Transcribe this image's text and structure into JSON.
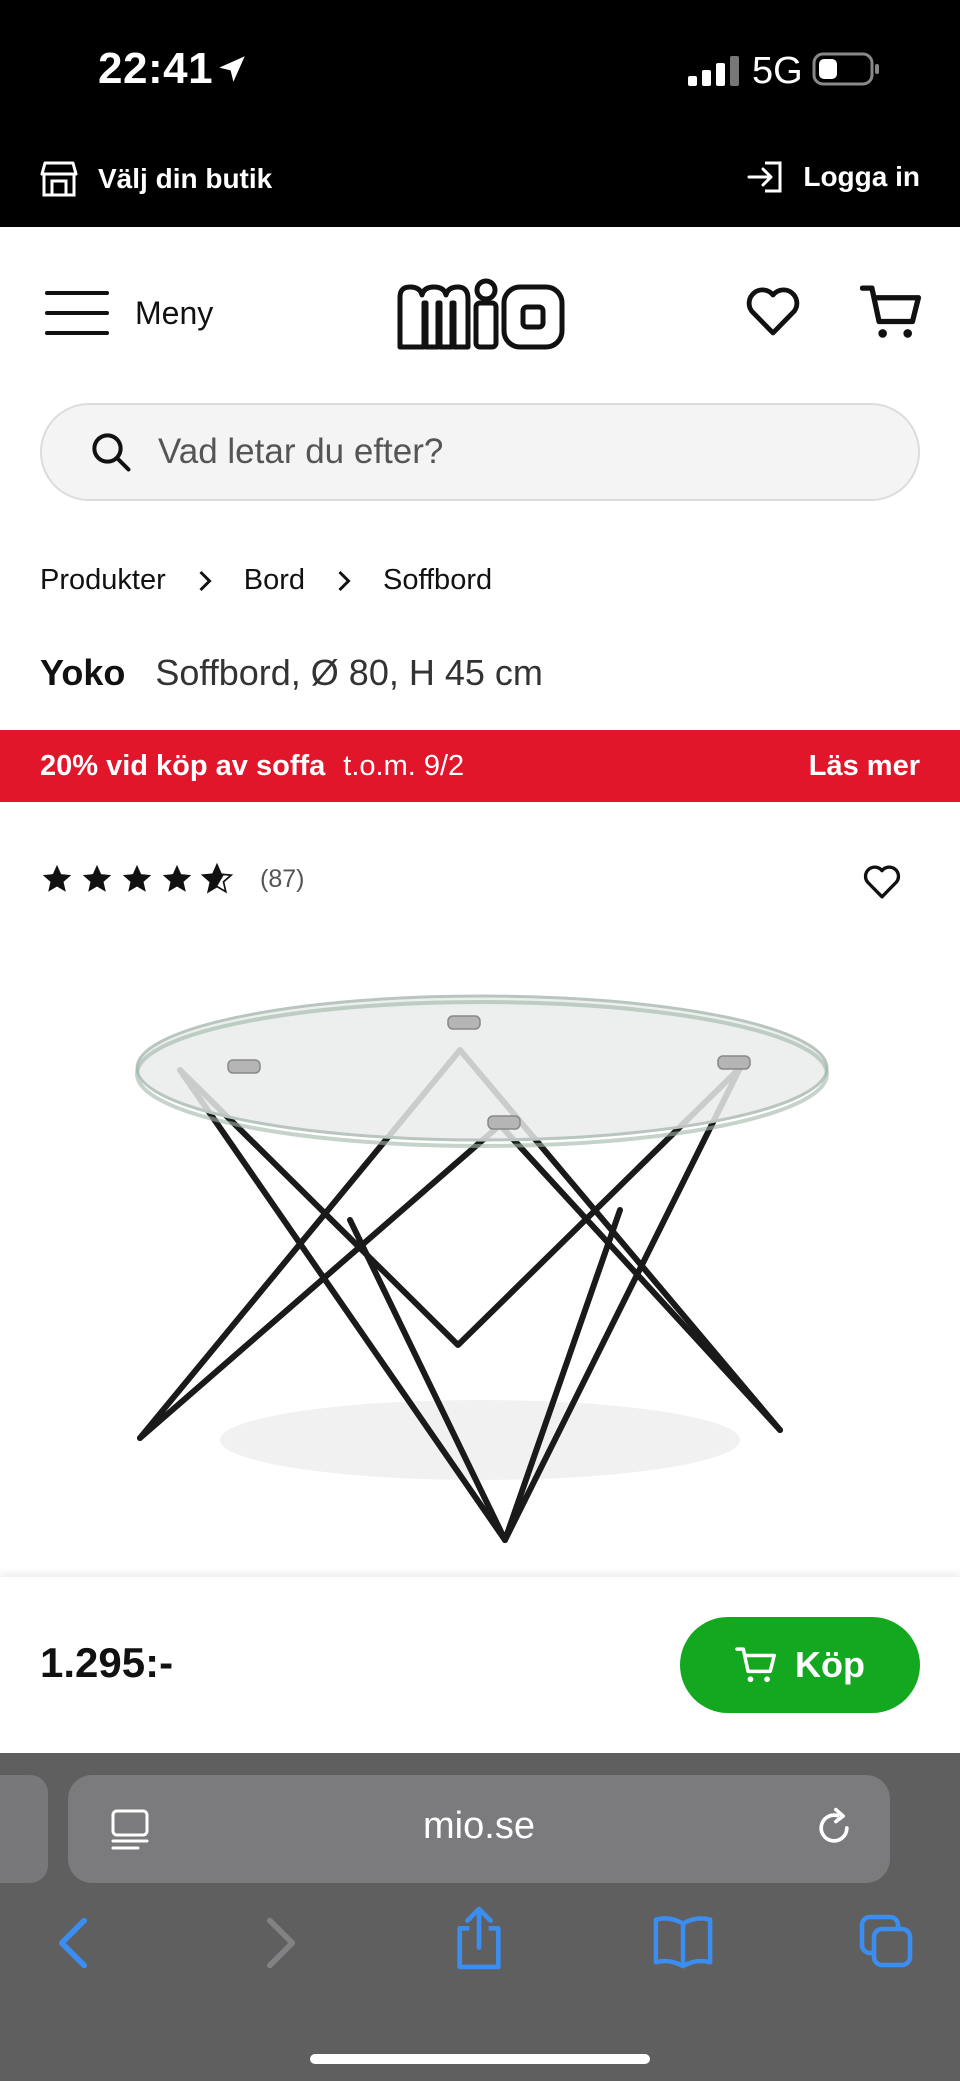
{
  "status_bar": {
    "time": "22:41",
    "network": "5G"
  },
  "util_bar": {
    "store_label": "Välj din butik",
    "login_label": "Logga in"
  },
  "header": {
    "menu_label": "Meny",
    "logo_text": "mio"
  },
  "search": {
    "placeholder": "Vad letar du efter?"
  },
  "breadcrumb": [
    "Produkter",
    "Bord",
    "Soffbord"
  ],
  "product": {
    "brand": "Yoko",
    "description": "Soffbord, Ø 80, H 45 cm",
    "rating_count": "(87)",
    "rating_value": 4.5,
    "price": "1.295:-",
    "buy_label": "Köp"
  },
  "promo": {
    "main": "20% vid köp av soffa",
    "date": "t.o.m. 9/2",
    "more": "Läs mer",
    "color": "#e2162b"
  },
  "browser": {
    "url": "mio.se"
  },
  "colors": {
    "buy_button": "#14a820",
    "promo": "#e2162b"
  }
}
